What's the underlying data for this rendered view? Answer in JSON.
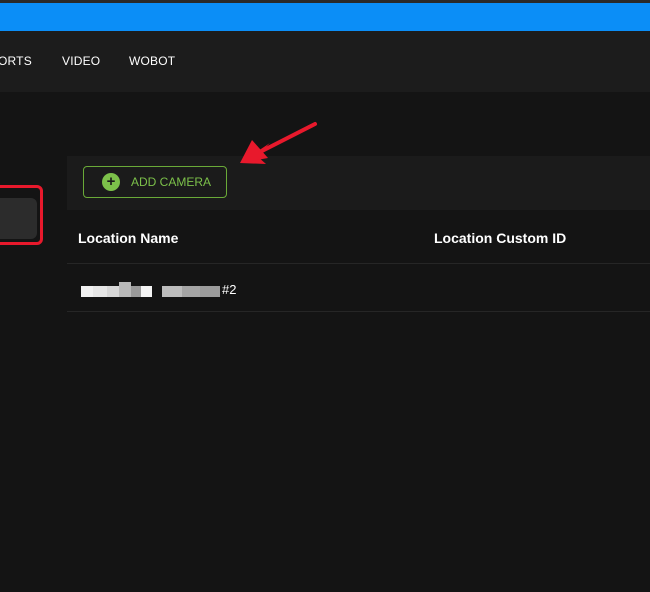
{
  "colors": {
    "accent_bar": "#0b8ef7",
    "button_green": "#7cc04a",
    "highlight_red": "#e8192c"
  },
  "nav": {
    "items": [
      {
        "label": "ORTS"
      },
      {
        "label": "VIDEO"
      },
      {
        "label": "WOBOT"
      }
    ]
  },
  "toolbar": {
    "add_camera_label": "ADD CAMERA",
    "add_icon": "plus-circle-icon"
  },
  "table": {
    "columns": [
      "Location Name",
      "Location Custom ID"
    ],
    "rows": [
      {
        "name_visible_suffix": "#2",
        "custom_id": ""
      }
    ]
  }
}
